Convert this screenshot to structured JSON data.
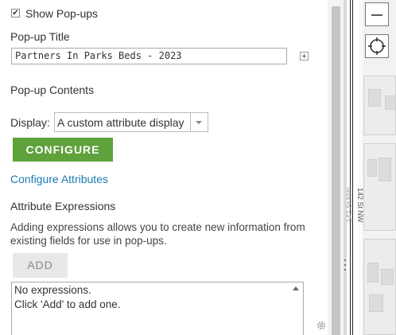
{
  "popup": {
    "show_popups_checked": true,
    "show_popups_label": "Show Pop-ups",
    "title_label": "Pop-up Title",
    "title_value": "Partners In Parks Beds - 2023",
    "contents_label": "Pop-up Contents",
    "display_label": "Display:",
    "display_value": "A custom attribute display",
    "configure_button": "CONFIGURE",
    "configure_attributes_link": "Configure Attributes",
    "attribute_expressions_label": "Attribute Expressions",
    "expressions_description": "Adding expressions allows you to create new information from existing fields for use in pop-ups.",
    "add_button": "ADD",
    "expressions_empty_line1": "No expressions.",
    "expressions_empty_line2": "Click 'Add' to add one."
  },
  "map": {
    "street_label": "142 St NW",
    "street_label_faint": "142 St NW"
  },
  "icons": {
    "check": "check-icon",
    "add_title_field": "plus-box-icon",
    "dropdown": "chevron-down-icon",
    "settings": "gear-icon",
    "zoom_out": "minus-icon",
    "locate": "locate-icon"
  },
  "colors": {
    "configure_button": "#5fa13b",
    "link": "#1a7bb5"
  }
}
